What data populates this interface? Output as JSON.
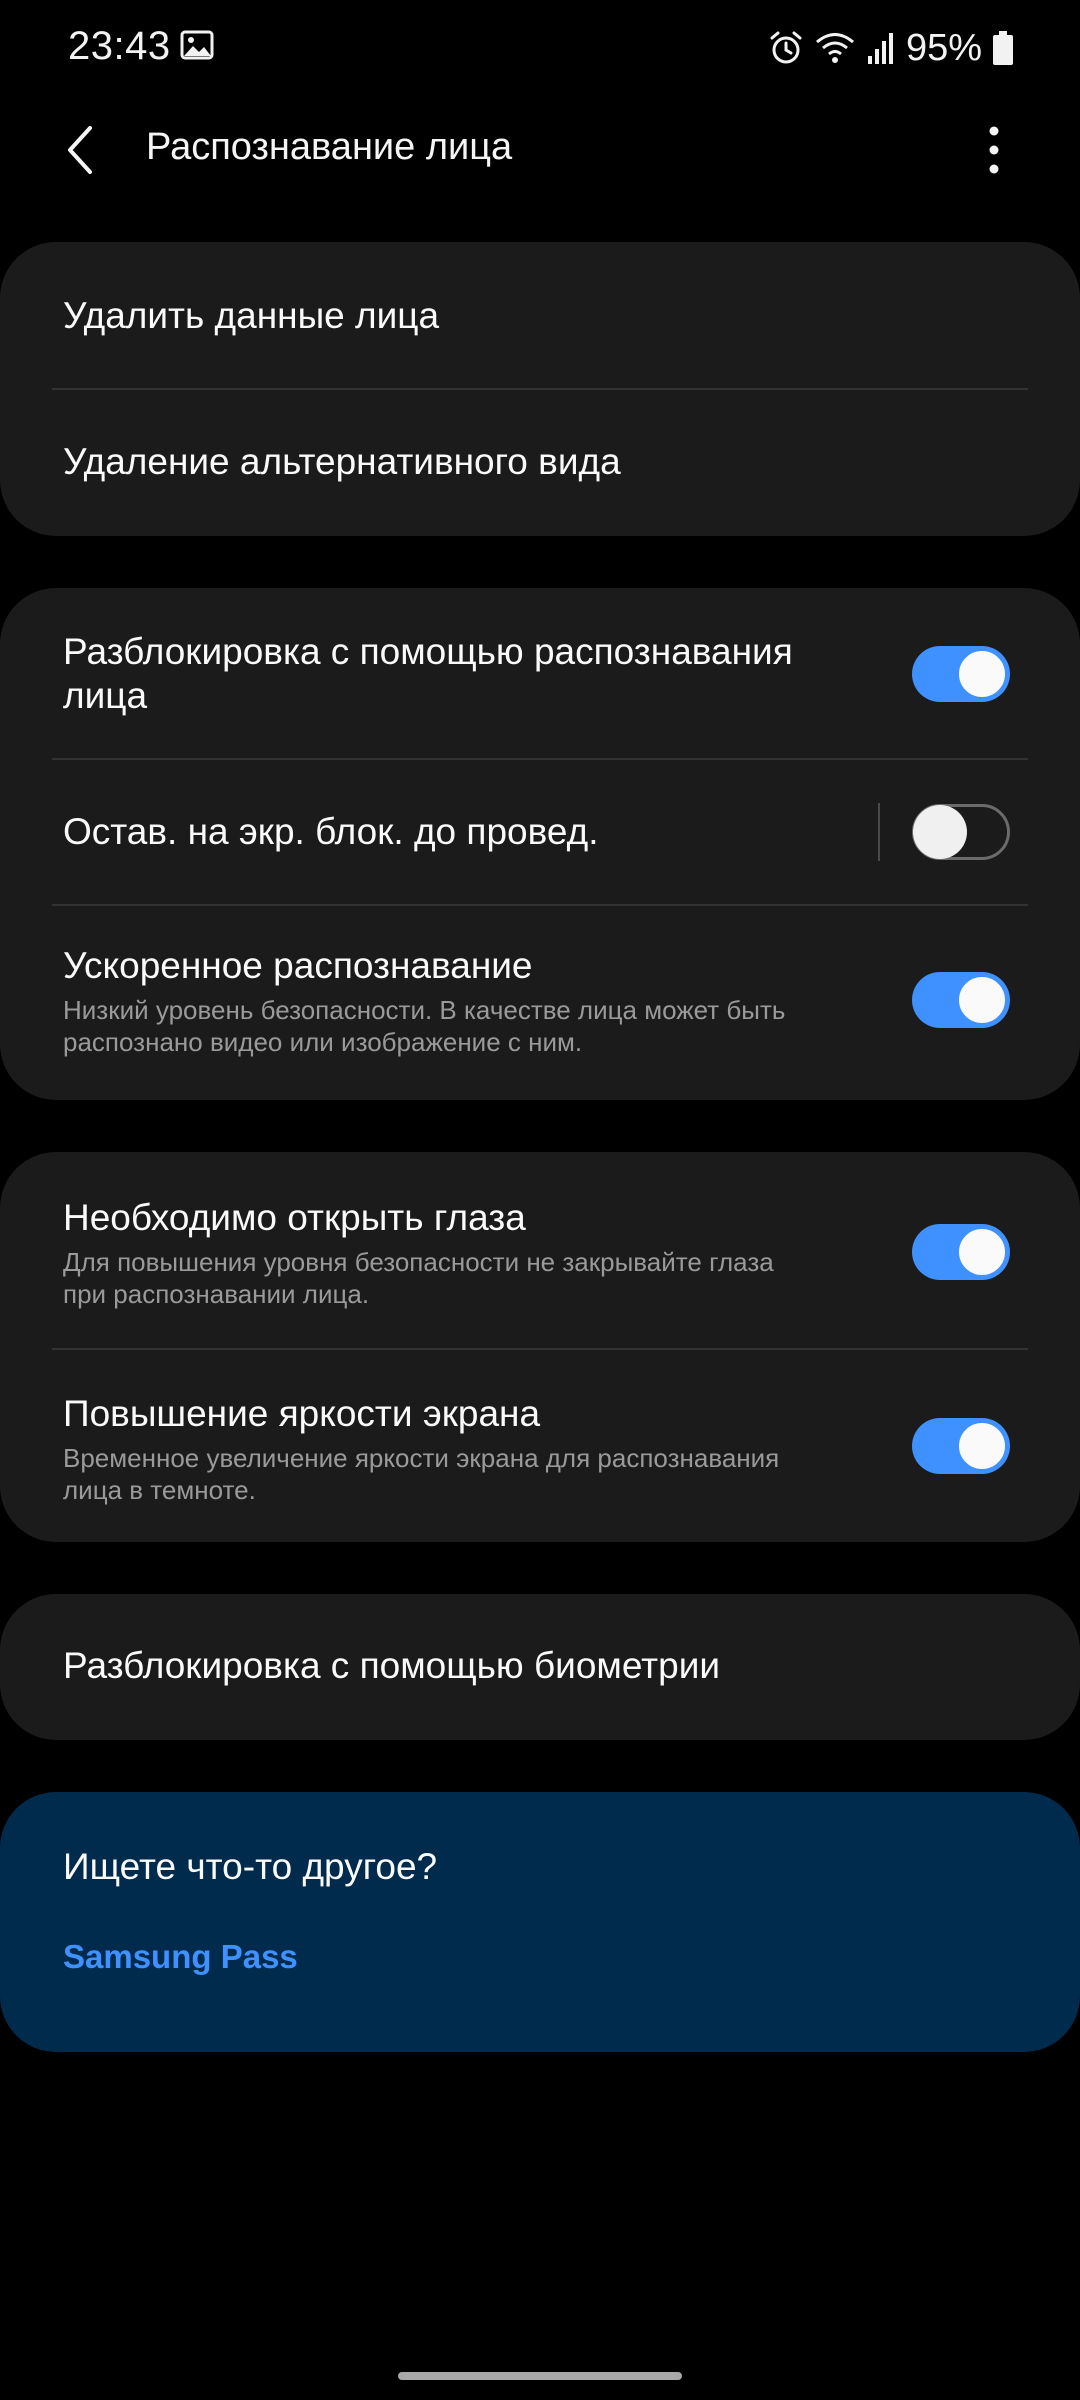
{
  "status_bar": {
    "time": "23:43",
    "battery": "95%",
    "icons": [
      "gallery-icon",
      "alarm-icon",
      "wifi-icon",
      "signal-icon",
      "battery-icon"
    ]
  },
  "app_bar": {
    "title": "Распознавание лица",
    "back_icon": "chevron-left-icon",
    "more_icon": "more-vertical-icon"
  },
  "group1": {
    "delete_face_data": "Удалить данные лица",
    "delete_alt_look": "Удаление альтернативного вида"
  },
  "group2": {
    "face_unlock": {
      "title_line1": "Разблокировка с помощью распознавания",
      "title_line2": "лица",
      "enabled": true
    },
    "stay_on_lock": {
      "title": "Остав. на экр. блок. до провед.",
      "enabled": false
    },
    "faster_recognition": {
      "title": "Ускоренное распознавание",
      "desc_line1": "Низкий уровень безопасности. В качестве лица может быть",
      "desc_line2": "распознано видео или изображение с ним.",
      "enabled": true
    }
  },
  "group3": {
    "open_eyes": {
      "title": "Необходимо открыть глаза",
      "desc_line1": "Для повышения уровня безопасности не закрывайте глаза",
      "desc_line2": "при распознавании лица.",
      "enabled": true
    },
    "brighten_screen": {
      "title": "Повышение яркости экрана",
      "desc_line1": "Временное увеличение яркости экрана для распознавания",
      "desc_line2": "лица в темноте.",
      "enabled": true
    }
  },
  "group4": {
    "biometrics_unlock": "Разблокировка с помощью биометрии"
  },
  "help": {
    "title": "Ищете что-то другое?",
    "link": "Samsung Pass"
  },
  "colors": {
    "background": "#000000",
    "card": "#1b1b1b",
    "accent": "#3e91ff",
    "help_card": "#012b4d",
    "secondary_text": "#9a9a9a"
  }
}
